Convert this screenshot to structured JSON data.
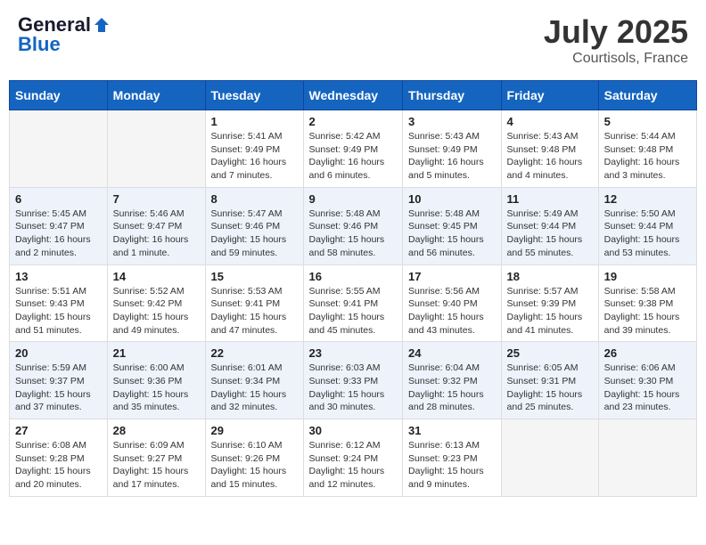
{
  "header": {
    "logo_general": "General",
    "logo_blue": "Blue",
    "month": "July 2025",
    "location": "Courtisols, France"
  },
  "days_of_week": [
    "Sunday",
    "Monday",
    "Tuesday",
    "Wednesday",
    "Thursday",
    "Friday",
    "Saturday"
  ],
  "weeks": [
    [
      {
        "day": "",
        "info": ""
      },
      {
        "day": "",
        "info": ""
      },
      {
        "day": "1",
        "info": "Sunrise: 5:41 AM\nSunset: 9:49 PM\nDaylight: 16 hours and 7 minutes."
      },
      {
        "day": "2",
        "info": "Sunrise: 5:42 AM\nSunset: 9:49 PM\nDaylight: 16 hours and 6 minutes."
      },
      {
        "day": "3",
        "info": "Sunrise: 5:43 AM\nSunset: 9:49 PM\nDaylight: 16 hours and 5 minutes."
      },
      {
        "day": "4",
        "info": "Sunrise: 5:43 AM\nSunset: 9:48 PM\nDaylight: 16 hours and 4 minutes."
      },
      {
        "day": "5",
        "info": "Sunrise: 5:44 AM\nSunset: 9:48 PM\nDaylight: 16 hours and 3 minutes."
      }
    ],
    [
      {
        "day": "6",
        "info": "Sunrise: 5:45 AM\nSunset: 9:47 PM\nDaylight: 16 hours and 2 minutes."
      },
      {
        "day": "7",
        "info": "Sunrise: 5:46 AM\nSunset: 9:47 PM\nDaylight: 16 hours and 1 minute."
      },
      {
        "day": "8",
        "info": "Sunrise: 5:47 AM\nSunset: 9:46 PM\nDaylight: 15 hours and 59 minutes."
      },
      {
        "day": "9",
        "info": "Sunrise: 5:48 AM\nSunset: 9:46 PM\nDaylight: 15 hours and 58 minutes."
      },
      {
        "day": "10",
        "info": "Sunrise: 5:48 AM\nSunset: 9:45 PM\nDaylight: 15 hours and 56 minutes."
      },
      {
        "day": "11",
        "info": "Sunrise: 5:49 AM\nSunset: 9:44 PM\nDaylight: 15 hours and 55 minutes."
      },
      {
        "day": "12",
        "info": "Sunrise: 5:50 AM\nSunset: 9:44 PM\nDaylight: 15 hours and 53 minutes."
      }
    ],
    [
      {
        "day": "13",
        "info": "Sunrise: 5:51 AM\nSunset: 9:43 PM\nDaylight: 15 hours and 51 minutes."
      },
      {
        "day": "14",
        "info": "Sunrise: 5:52 AM\nSunset: 9:42 PM\nDaylight: 15 hours and 49 minutes."
      },
      {
        "day": "15",
        "info": "Sunrise: 5:53 AM\nSunset: 9:41 PM\nDaylight: 15 hours and 47 minutes."
      },
      {
        "day": "16",
        "info": "Sunrise: 5:55 AM\nSunset: 9:41 PM\nDaylight: 15 hours and 45 minutes."
      },
      {
        "day": "17",
        "info": "Sunrise: 5:56 AM\nSunset: 9:40 PM\nDaylight: 15 hours and 43 minutes."
      },
      {
        "day": "18",
        "info": "Sunrise: 5:57 AM\nSunset: 9:39 PM\nDaylight: 15 hours and 41 minutes."
      },
      {
        "day": "19",
        "info": "Sunrise: 5:58 AM\nSunset: 9:38 PM\nDaylight: 15 hours and 39 minutes."
      }
    ],
    [
      {
        "day": "20",
        "info": "Sunrise: 5:59 AM\nSunset: 9:37 PM\nDaylight: 15 hours and 37 minutes."
      },
      {
        "day": "21",
        "info": "Sunrise: 6:00 AM\nSunset: 9:36 PM\nDaylight: 15 hours and 35 minutes."
      },
      {
        "day": "22",
        "info": "Sunrise: 6:01 AM\nSunset: 9:34 PM\nDaylight: 15 hours and 32 minutes."
      },
      {
        "day": "23",
        "info": "Sunrise: 6:03 AM\nSunset: 9:33 PM\nDaylight: 15 hours and 30 minutes."
      },
      {
        "day": "24",
        "info": "Sunrise: 6:04 AM\nSunset: 9:32 PM\nDaylight: 15 hours and 28 minutes."
      },
      {
        "day": "25",
        "info": "Sunrise: 6:05 AM\nSunset: 9:31 PM\nDaylight: 15 hours and 25 minutes."
      },
      {
        "day": "26",
        "info": "Sunrise: 6:06 AM\nSunset: 9:30 PM\nDaylight: 15 hours and 23 minutes."
      }
    ],
    [
      {
        "day": "27",
        "info": "Sunrise: 6:08 AM\nSunset: 9:28 PM\nDaylight: 15 hours and 20 minutes."
      },
      {
        "day": "28",
        "info": "Sunrise: 6:09 AM\nSunset: 9:27 PM\nDaylight: 15 hours and 17 minutes."
      },
      {
        "day": "29",
        "info": "Sunrise: 6:10 AM\nSunset: 9:26 PM\nDaylight: 15 hours and 15 minutes."
      },
      {
        "day": "30",
        "info": "Sunrise: 6:12 AM\nSunset: 9:24 PM\nDaylight: 15 hours and 12 minutes."
      },
      {
        "day": "31",
        "info": "Sunrise: 6:13 AM\nSunset: 9:23 PM\nDaylight: 15 hours and 9 minutes."
      },
      {
        "day": "",
        "info": ""
      },
      {
        "day": "",
        "info": ""
      }
    ]
  ]
}
